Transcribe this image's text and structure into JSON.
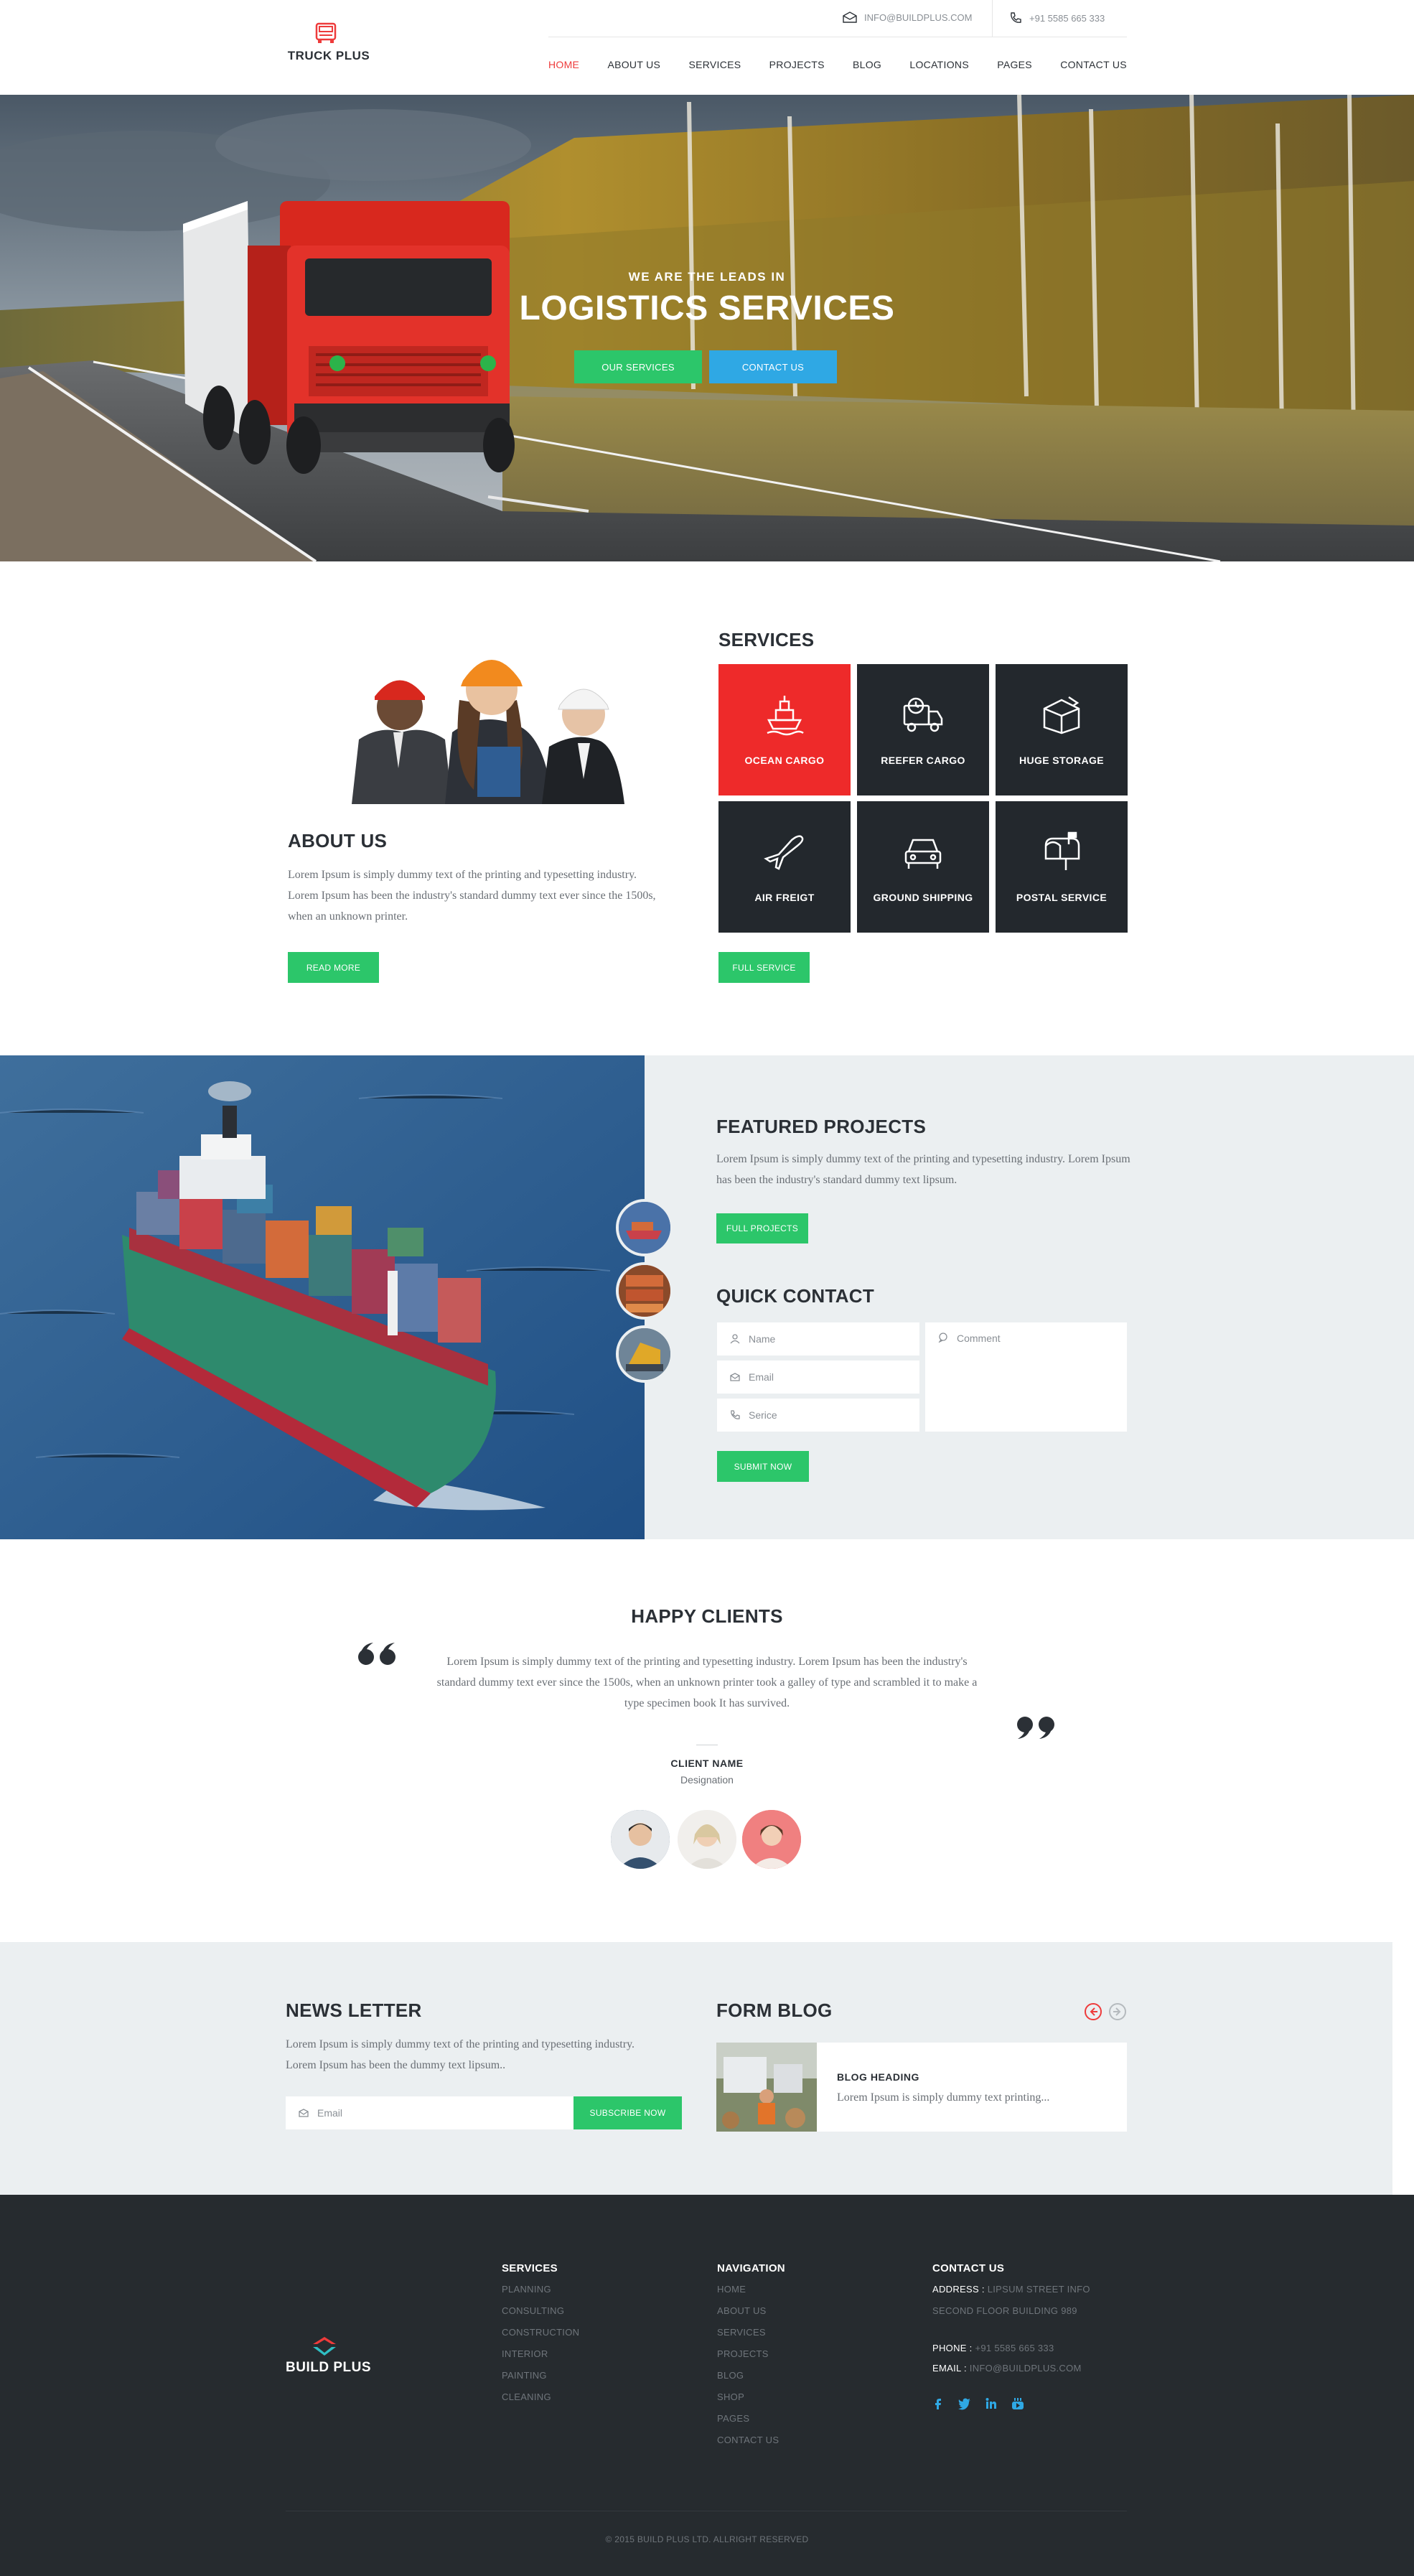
{
  "brand": {
    "name": "TRUCK PLUS"
  },
  "topbar": {
    "email": "INFO@BUILDPLUS.COM",
    "phone": "+91 5585 665 333"
  },
  "nav": [
    "HOME",
    "ABOUT US",
    "SERVICES",
    "PROJECTS",
    "BLOG",
    "LOCATIONS",
    "PAGES",
    "CONTACT US"
  ],
  "hero": {
    "kicker": "WE ARE THE LEADS IN",
    "title": "LOGISTICS SERVICES",
    "btn_services": "OUR SERVICES",
    "btn_contact": "CONTACT US"
  },
  "about": {
    "title": "ABOUT US",
    "text": "Lorem Ipsum is simply dummy text of the printing and typesetting industry. Lorem Ipsum has been the industry's standard dummy text ever since the 1500s, when an unknown printer.",
    "button": "READ MORE"
  },
  "services": {
    "title": "SERVICES",
    "items": [
      "OCEAN CARGO",
      "REEFER CARGO",
      "HUGE STORAGE",
      "AIR FREIGT",
      "GROUND SHIPPING",
      "POSTAL SERVICE"
    ],
    "button": "FULL SERVICE"
  },
  "featured": {
    "title": "FEATURED PROJECTS",
    "text": "Lorem Ipsum is simply dummy text of the printing and typesetting industry. Lorem Ipsum has been the industry's standard dummy text lipsum.",
    "button": "FULL PROJECTS"
  },
  "quick_contact": {
    "title": "QUICK CONTACT",
    "name_placeholder": "Name",
    "email_placeholder": "Email",
    "service_placeholder": "Serice",
    "comment_placeholder": "Comment",
    "button": "SUBMIT NOW"
  },
  "clients": {
    "title": "HAPPY CLIENTS",
    "quote": "Lorem Ipsum is simply dummy text of the printing and typesetting industry. Lorem Ipsum has been the industry's standard dummy text ever since the 1500s, when an unknown printer took a galley of type and scrambled it to make a type specimen book It has survived.",
    "client_name": "CLIENT NAME",
    "designation": "Designation"
  },
  "newsletter": {
    "title": "NEWS LETTER",
    "text": "Lorem Ipsum is simply dummy text of the printing and typesetting industry. Lorem Ipsum has been the dummy text lipsum..",
    "email_placeholder": "Email",
    "button": "SUBSCRIBE NOW"
  },
  "blog": {
    "title": "FORM BLOG",
    "post_heading": "BLOG HEADING",
    "post_excerpt": "Lorem Ipsum is simply dummy text printing..."
  },
  "footer": {
    "brand": "BUILD PLUS",
    "services_title": "SERVICES",
    "services": [
      "PLANNING",
      "CONSULTING",
      "CONSTRUCTION",
      "INTERIOR",
      "PAINTING",
      "CLEANING"
    ],
    "navigation_title": "NAVIGATION",
    "navigation": [
      "HOME",
      "ABOUT US",
      "SERVICES",
      "PROJECTS",
      "BLOG",
      "SHOP",
      "PAGES",
      "CONTACT US"
    ],
    "contact_title": "CONTACT US",
    "address_label": "ADDRESS :",
    "address_line1": "LIPSUM STREET INFO",
    "address_line2": "SECOND FLOOR BUILDING 989",
    "phone_label": "PHONE :",
    "phone": "+91 5585 665 333",
    "email_label": "EMAIL :",
    "email": "INFO@BUILDPLUS.COM",
    "copyright": "© 2015 BUILD PLUS LTD. ALLRIGHT RESERVED"
  },
  "colors": {
    "accent_red": "#ee3b3b",
    "green": "#2cc66a",
    "blue": "#2fa8e4",
    "dark": "#23282d"
  }
}
